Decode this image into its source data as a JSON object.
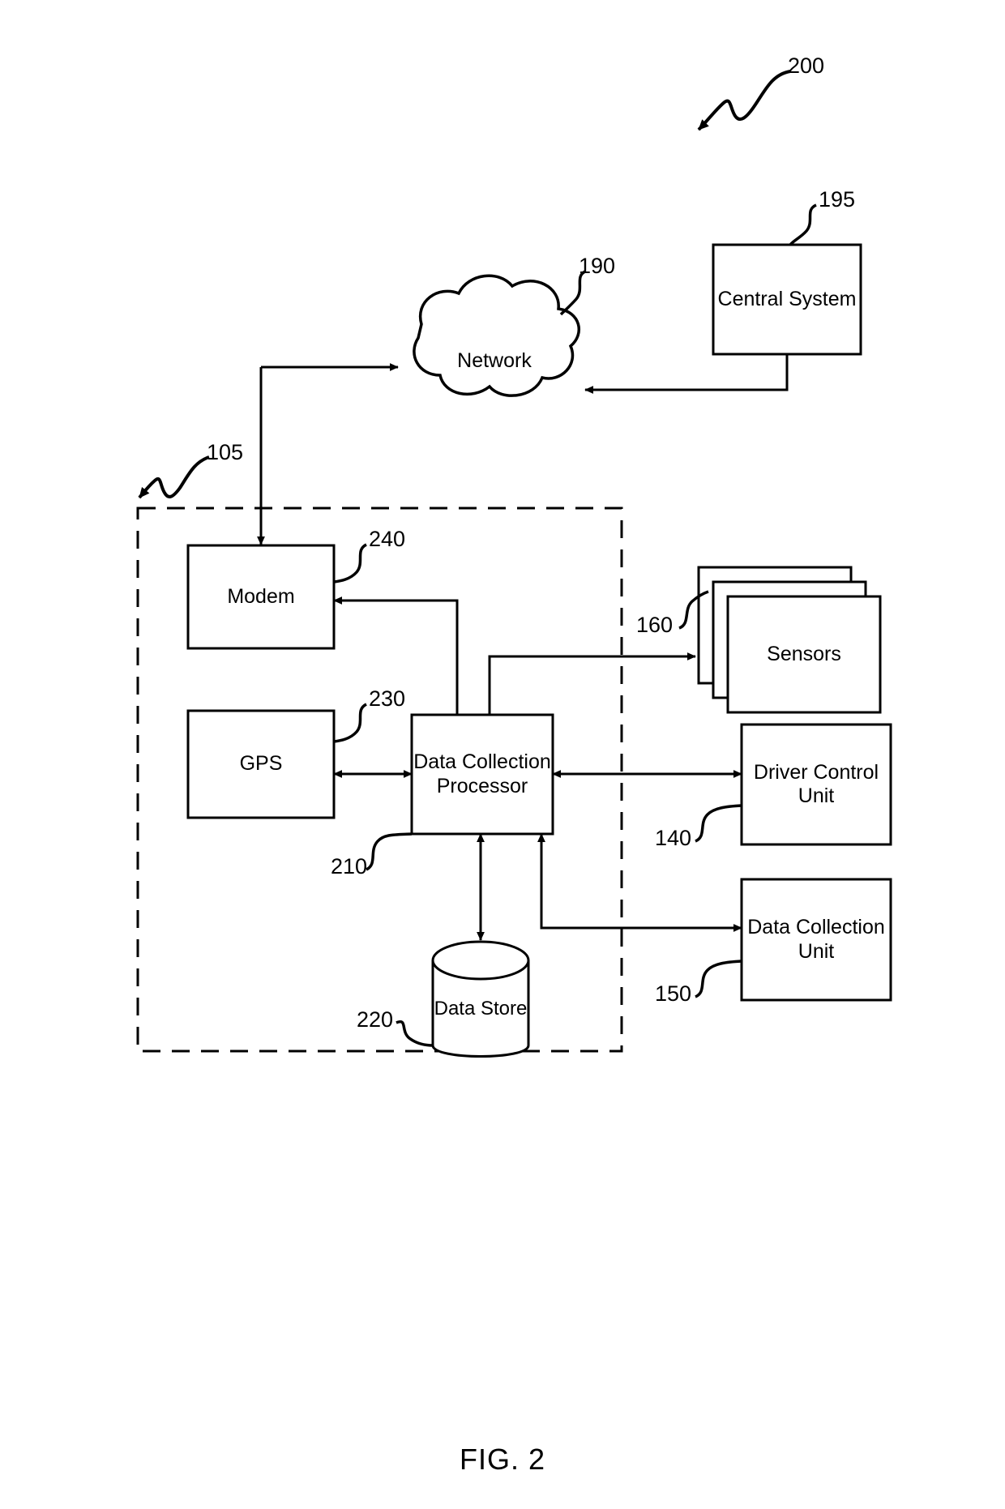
{
  "figure": {
    "caption": "FIG. 2",
    "system_ref": "200"
  },
  "nodes": [
    {
      "id": "central-system",
      "label": "Central System",
      "ref": "195",
      "shape": "rect"
    },
    {
      "id": "network",
      "label": "Network",
      "ref": "190",
      "shape": "cloud"
    },
    {
      "id": "vehicle-boundary",
      "label": "",
      "ref": "105",
      "shape": "dashed-rect"
    },
    {
      "id": "modem",
      "label": "Modem",
      "ref": "240",
      "shape": "rect"
    },
    {
      "id": "gps",
      "label": "GPS",
      "ref": "230",
      "shape": "rect"
    },
    {
      "id": "data-collection-processor",
      "label": "Data Collection Processor",
      "ref": "210",
      "shape": "rect"
    },
    {
      "id": "data-store",
      "label": "Data Store",
      "ref": "220",
      "shape": "cylinder"
    },
    {
      "id": "sensors",
      "label": "Sensors",
      "ref": "160",
      "shape": "stacked-rect"
    },
    {
      "id": "driver-control-unit",
      "label": "Driver Control Unit",
      "ref": "140",
      "shape": "rect"
    },
    {
      "id": "data-collection-unit",
      "label": "Data Collection Unit",
      "ref": "150",
      "shape": "rect"
    }
  ],
  "node_text": {
    "central_system": "Central System",
    "network": "Network",
    "modem": "Modem",
    "gps": "GPS",
    "data_collection_processor": "Data Collection Processor",
    "data_store": "Data Store",
    "sensors": "Sensors",
    "driver_control_unit": "Driver Control Unit",
    "data_collection_unit": "Data Collection Unit"
  },
  "ref_numerals": {
    "system": "200",
    "central_system": "195",
    "network": "190",
    "vehicle_boundary": "105",
    "modem": "240",
    "gps": "230",
    "data_collection_processor": "210",
    "data_store": "220",
    "sensors": "160",
    "driver_control_unit": "140",
    "data_collection_unit": "150"
  },
  "connections": [
    {
      "from": "modem",
      "to": "network",
      "direction": "one-way"
    },
    {
      "from": "central-system",
      "to": "network",
      "direction": "one-way"
    },
    {
      "from": "network",
      "to": "modem",
      "direction": "one-way"
    },
    {
      "from": "data-collection-processor",
      "to": "modem",
      "direction": "one-way"
    },
    {
      "from": "data-collection-processor",
      "to": "sensors",
      "direction": "one-way"
    },
    {
      "from": "gps",
      "to": "data-collection-processor",
      "direction": "two-way"
    },
    {
      "from": "data-collection-processor",
      "to": "driver-control-unit",
      "direction": "two-way"
    },
    {
      "from": "data-collection-processor",
      "to": "data-store",
      "direction": "two-way"
    },
    {
      "from": "data-collection-processor",
      "to": "data-collection-unit",
      "direction": "one-way"
    }
  ],
  "style": {
    "stroke": "#000000",
    "background": "#ffffff"
  }
}
